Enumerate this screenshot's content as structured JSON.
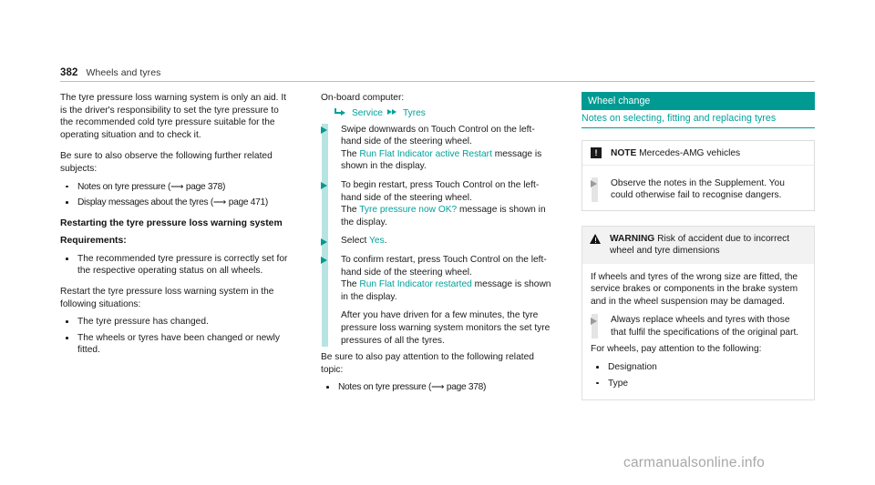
{
  "header": {
    "page_number": "382",
    "chapter": "Wheels and tyres"
  },
  "colors": {
    "teal": "#00a19a",
    "teal_bar": "#009a93",
    "teal_rail": "#b7e4e2",
    "gray_rail": "#e4e4e4",
    "warn_head_bg": "#f2f2f2",
    "watermark": "#a8a8a8"
  },
  "left_column": {
    "intro": "The tyre pressure loss warning system is only an aid. It is the driver's responsibility to set the tyre pressure to the recommended cold tyre pressure suitable for the operating situation and to check it.",
    "observe_lead": "Be sure to also observe the following further related subjects:",
    "observe_bullets": [
      "Notes on tyre pressure (⟶ page 378)",
      "Display messages about the tyres (⟶ page 471)"
    ],
    "restart_heading": "Restarting the tyre pressure loss warning system",
    "requirements_heading": "Requirements:",
    "requirements_bullets": [
      "The recommended tyre pressure is correctly set for the respective operating status on all wheels."
    ],
    "restart_lead": "Restart the tyre pressure loss warning system in the following situations:",
    "restart_bullets": [
      "The tyre pressure has changed.",
      "The wheels or tyres have been changed or newly fitted."
    ]
  },
  "middle_column": {
    "obc_label": "On-board computer:",
    "path": {
      "first_icon": "corner-arrow-icon",
      "first_label": "Service",
      "second_icon": "double-chevron-icon",
      "second_label": "Tyres"
    },
    "steps": [
      {
        "text_before": "Swipe downwards on Touch Control on the left-hand side of the steering wheel.",
        "line2_prefix": "The ",
        "link": "Run Flat Indicator active Restart",
        "line2_suffix": " message is shown in the display."
      },
      {
        "text_before": "To begin restart, press Touch Control on the left-hand side of the steering wheel.",
        "line2_prefix": "The ",
        "link": "Tyre pressure now OK?",
        "line2_suffix": " message is shown in the display."
      },
      {
        "text_before": "Select ",
        "link": "Yes",
        "line2_suffix": "."
      },
      {
        "text_before": "To confirm restart, press Touch Control on the left-hand side of the steering wheel.",
        "line2_prefix": "The ",
        "link": "Run Flat Indicator restarted",
        "line2_suffix": " message is shown in the display."
      }
    ],
    "after_note": "After you have driven for a few minutes, the tyre pressure loss warning system monitors the set tyre pressures of all the tyres.",
    "related_lead": "Be sure to also pay attention to the following related topic:",
    "related_bullets": [
      "Notes on tyre pressure (⟶ page 378)"
    ]
  },
  "right_column": {
    "section_title": "Wheel change",
    "section_subtitle": "Notes on selecting, fitting and replacing tyres",
    "note_box": {
      "icon": "note-exclamation-icon",
      "icon_glyph": "!",
      "label": "NOTE",
      "title": "Mercedes-AMG vehicles",
      "steps": [
        "Observe the notes in the Supplement. You could otherwise fail to recognise dangers."
      ]
    },
    "warning_box": {
      "icon": "warning-triangle-icon",
      "label": "WARNING",
      "title": "Risk of accident due to incorrect wheel and tyre dimensions",
      "body": "If wheels and tyres of the wrong size are fitted, the service brakes or components in the brake system and in the wheel suspension may be damaged.",
      "steps": [
        "Always replace wheels and tyres with those that fulfil the specifications of the original part."
      ],
      "closing_lead": "For wheels, pay attention to the following:",
      "closing_bullets": [
        "Designation",
        "Type"
      ]
    }
  },
  "watermark": {
    "text": "carmanualsonline.info"
  }
}
